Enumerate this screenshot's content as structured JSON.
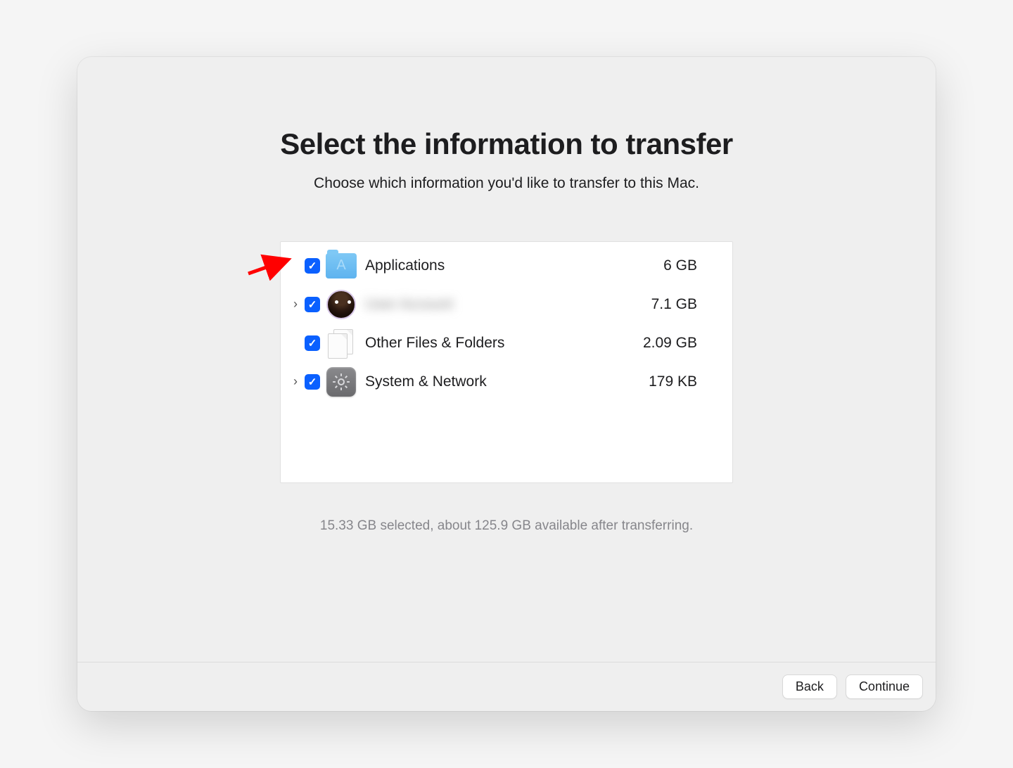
{
  "header": {
    "title": "Select the information to transfer",
    "subtitle": "Choose which information you'd like to transfer to this Mac."
  },
  "items": [
    {
      "label": "Applications",
      "size": "6 GB",
      "expandable": false,
      "checked": true,
      "icon": "applications-folder"
    },
    {
      "label": "User Account",
      "size": "7.1 GB",
      "expandable": true,
      "checked": true,
      "icon": "avatar",
      "blurred": true
    },
    {
      "label": "Other Files & Folders",
      "size": "2.09 GB",
      "expandable": false,
      "checked": true,
      "icon": "documents"
    },
    {
      "label": "System & Network",
      "size": "179 KB",
      "expandable": true,
      "checked": true,
      "icon": "system-preferences"
    }
  ],
  "status": "15.33 GB selected, about 125.9 GB available after transferring.",
  "buttons": {
    "back": "Back",
    "continue": "Continue"
  }
}
